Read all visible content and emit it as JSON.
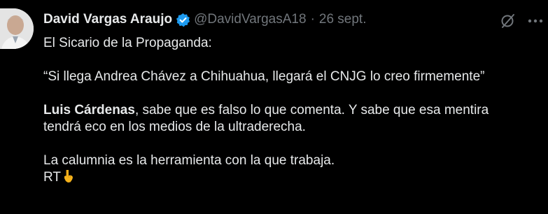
{
  "tweet": {
    "author_name": "David Vargas Araujo",
    "handle": "@DavidVargasA18",
    "separator": "·",
    "date": "26 sept.",
    "lines": {
      "l1": "El Sicario de la Propaganda:",
      "l2": "“Si llega Andrea Chávez a Chihuahua, llegará el CNJG lo creo firmemente”",
      "l3_bold": "Luis Cárdenas",
      "l3_rest": ", sabe que es falso lo que comenta. Y sabe que esa mentira",
      "l4": "tendrá eco en los medios de la ultraderecha.",
      "l5": "La calumnia es la herramienta con la que trabaja.",
      "l6": "RT"
    }
  },
  "colors": {
    "background": "#000000",
    "text": "#e7e9ea",
    "muted": "#71767b",
    "verified": "#1d9bf0"
  },
  "icons": [
    "avatar",
    "verified-badge-icon",
    "grok-icon",
    "more-options-icon",
    "pointing-down-emoji-icon"
  ]
}
